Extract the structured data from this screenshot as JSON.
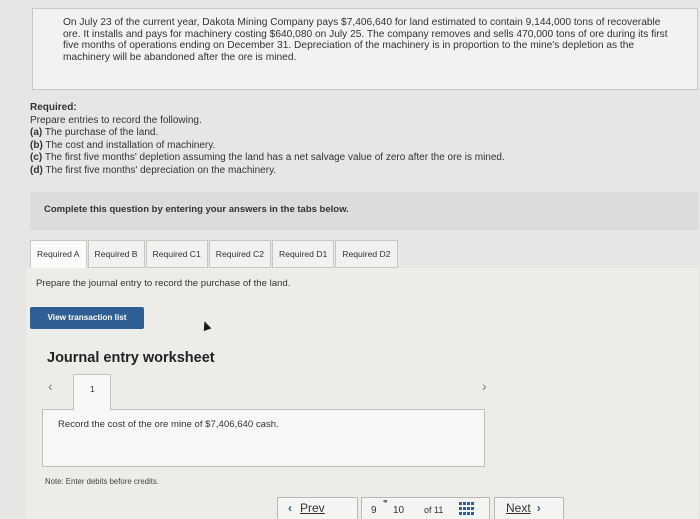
{
  "problem": {
    "text": "On July 23 of the current year, Dakota Mining Company pays $7,406,640 for land estimated to contain 9,144,000 tons of recoverable ore. It installs and pays for machinery costing $640,080 on July 25. The company removes and sells 470,000 tons of ore during its first five months of operations ending on December 31. Depreciation of the machinery is in proportion to the mine's depletion as the machinery will be abandoned after the ore is mined."
  },
  "required": {
    "heading": "Required:",
    "intro": "Prepare entries to record the following.",
    "items": [
      {
        "tag": "(a)",
        "text": " The purchase of the land."
      },
      {
        "tag": "(b)",
        "text": " The cost and installation of machinery."
      },
      {
        "tag": "(c)",
        "text": " The first five months' depletion assuming the land has a net salvage value of zero after the ore is mined."
      },
      {
        "tag": "(d)",
        "text": " The first five months' depreciation on the machinery."
      }
    ]
  },
  "instruction": "Complete this question by entering your answers in the tabs below.",
  "tabs": [
    "Required A",
    "Required B",
    "Required C1",
    "Required C2",
    "Required D1",
    "Required D2"
  ],
  "prepare_text": "Prepare the journal entry to record the purchase of the land.",
  "view_button": "View transaction list",
  "worksheet": {
    "title": "Journal entry worksheet",
    "page_number": "1",
    "entry_text": "Record the cost of the ore mine of $7,406,640 cash.",
    "note": "Note: Enter debits before credits."
  },
  "footer": {
    "prev_label": "Prev",
    "prev_num": "9",
    "current_num": "10",
    "of_total": "of 11",
    "next_label": "Next"
  }
}
